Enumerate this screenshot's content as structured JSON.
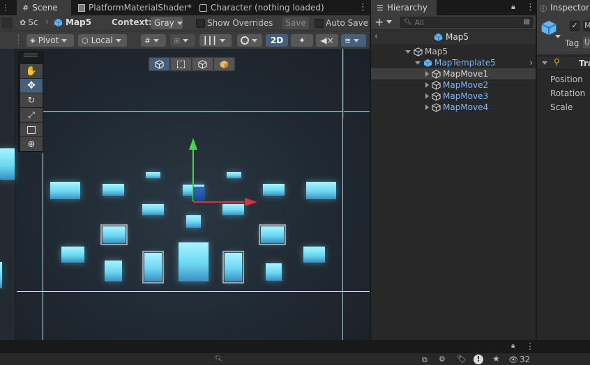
{
  "scene_window": {
    "tabs": [
      {
        "label": "Scene",
        "icon": "grid-icon"
      },
      {
        "label": "PlatformMaterialShader*",
        "icon": "shader-graph-icon"
      },
      {
        "label": "Character (nothing loaded)",
        "icon": "animator-icon"
      }
    ],
    "left_clip_label": "G",
    "breadcrumb": {
      "root": "Sc",
      "current": "Map5"
    },
    "context_label": "Context:",
    "context_value": "Gray",
    "show_overrides_label": "Show Overrides",
    "show_overrides_checked": false,
    "save_label": "Save",
    "auto_save_label": "Auto Save",
    "auto_save_checked": false,
    "pivot_label": "Pivot",
    "local_label": "Local",
    "mode_2d_label": "2D",
    "active_tool": "move",
    "tools": [
      "hand-icon",
      "move-icon",
      "rotate-icon",
      "scale-icon",
      "rect-tool-icon",
      "transform-tool-icon"
    ],
    "overlay_buttons": [
      "cube-wire-icon",
      "rect-select-icon",
      "cube-outline-icon",
      "cube-solid-icon"
    ]
  },
  "hierarchy": {
    "tab_label": "Hierarchy",
    "search_placeholder": "All",
    "scene_header": "Map5",
    "items": [
      {
        "label": "Map5",
        "depth": 0,
        "prefab": false,
        "expanded": true
      },
      {
        "label": "MapTemplate5",
        "depth": 1,
        "prefab": true,
        "expanded": true
      },
      {
        "label": "MapMove1",
        "depth": 2,
        "prefab": false,
        "expanded": false,
        "selected": true
      },
      {
        "label": "MapMove2",
        "depth": 2,
        "prefab": true,
        "expanded": false
      },
      {
        "label": "MapMove3",
        "depth": 2,
        "prefab": true,
        "expanded": false
      },
      {
        "label": "MapMove4",
        "depth": 2,
        "prefab": true,
        "expanded": false
      }
    ]
  },
  "inspector": {
    "tab_label": "Inspector",
    "tag_label": "Tag",
    "tag_value": "U",
    "name_clip": "M",
    "component_label": "Tra",
    "fields": [
      "Position",
      "Rotation",
      "Scale"
    ]
  },
  "bottom_bar": {
    "count": "32",
    "icons": [
      "search-icon",
      "toggle-icon",
      "paint-icon",
      "tag-icon",
      "warning-icon",
      "star-icon",
      "eye-icon"
    ]
  },
  "colors": {
    "accent_blue": "#46607c",
    "prefab_text": "#7fb4ff",
    "grid_line": "#b6f5a8",
    "block": "#6ad8f2"
  }
}
